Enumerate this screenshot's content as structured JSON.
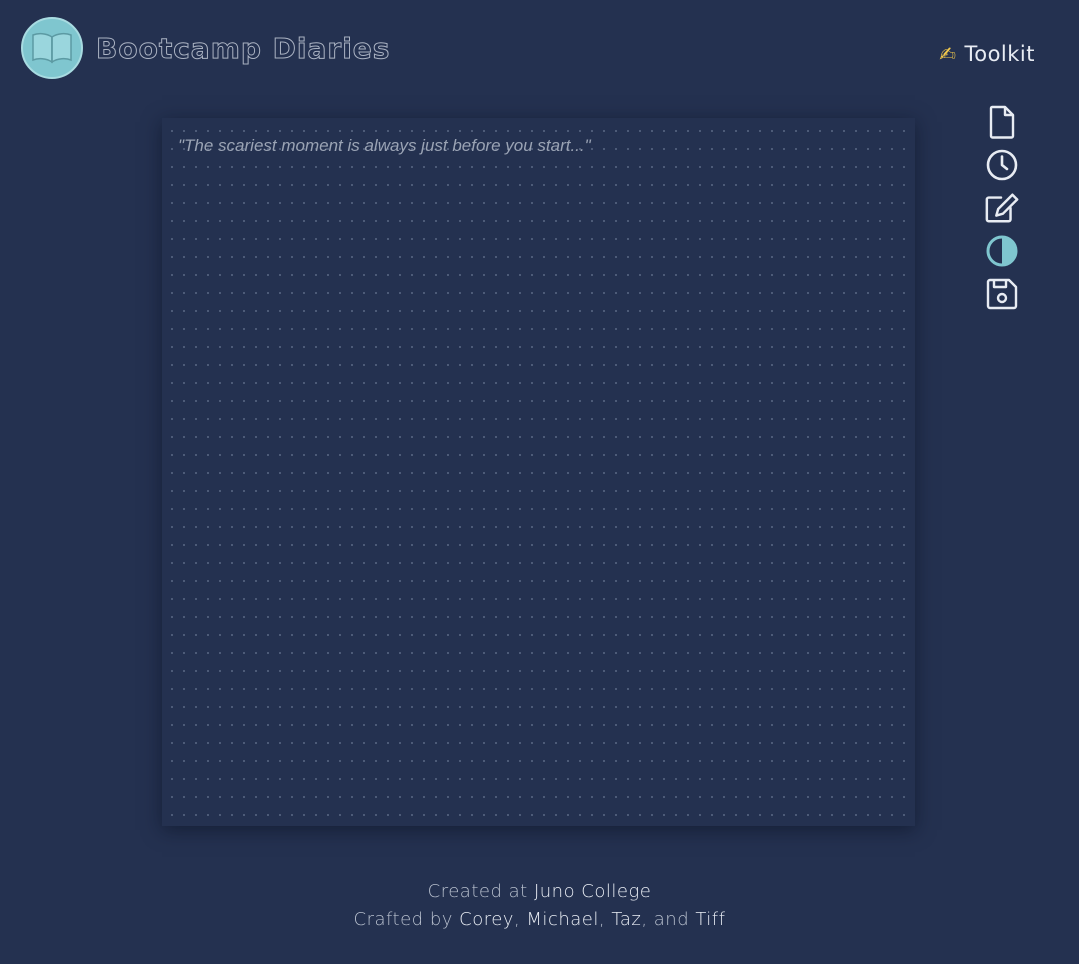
{
  "header": {
    "title": "Bootcamp Diaries",
    "logo_icon": "open-book-icon",
    "toolkit_emoji": "✍",
    "toolkit_label": "Toolkit"
  },
  "toolbar": {
    "items": [
      {
        "icon": "new-page-icon",
        "color": "#e8ecf3"
      },
      {
        "icon": "history-clock-icon",
        "color": "#e8ecf3"
      },
      {
        "icon": "edit-icon",
        "color": "#e8ecf3"
      },
      {
        "icon": "contrast-icon",
        "color": "#7fc6cf"
      },
      {
        "icon": "save-icon",
        "color": "#e8ecf3"
      }
    ]
  },
  "editor": {
    "placeholder": "\"The scariest moment is always just before you start...\"",
    "value": ""
  },
  "footer": {
    "created_prefix": "Created at ",
    "created_link": "Juno College",
    "crafted_prefix": "Crafted by ",
    "authors": [
      "Corey",
      "Michael",
      "Taz",
      "Tiff"
    ],
    "sep_1": ", ",
    "sep_2": ", ",
    "sep_3": ", and "
  },
  "colors": {
    "background": "#243150",
    "accent": "#7fc6cf",
    "text": "#e8ecf3"
  }
}
